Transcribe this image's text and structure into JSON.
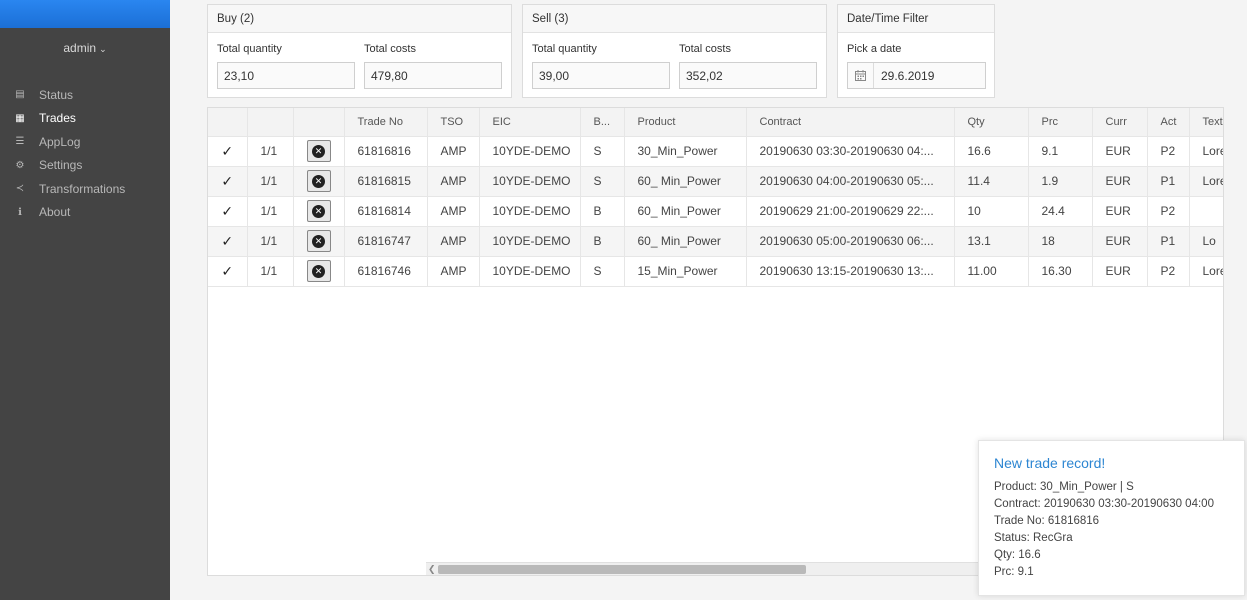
{
  "sidebar": {
    "user": "admin",
    "items": [
      {
        "label": "Status",
        "icon": "status-icon",
        "glyph": "▤",
        "active": false
      },
      {
        "label": "Trades",
        "icon": "document-icon",
        "glyph": "▦",
        "active": true
      },
      {
        "label": "AppLog",
        "icon": "list-icon",
        "glyph": "☰",
        "active": false
      },
      {
        "label": "Settings",
        "icon": "gear-icon",
        "glyph": "⚙",
        "active": false
      },
      {
        "label": "Transformations",
        "icon": "share-icon",
        "glyph": "≺",
        "active": false
      },
      {
        "label": "About",
        "icon": "info-icon",
        "glyph": "ℹ",
        "active": false
      }
    ]
  },
  "buy": {
    "title": "Buy (2)",
    "qty_label": "Total quantity",
    "qty_value": "23,10",
    "cost_label": "Total costs",
    "cost_value": "479,80"
  },
  "sell": {
    "title": "Sell (3)",
    "qty_label": "Total quantity",
    "qty_value": "39,00",
    "cost_label": "Total costs",
    "cost_value": "352,02"
  },
  "filter": {
    "title": "Date/Time Filter",
    "date_label": "Pick a date",
    "date_value": "29.6.2019"
  },
  "table": {
    "columns": [
      "",
      "",
      "",
      "Trade No",
      "TSO",
      "EIC",
      "B...",
      "Product",
      "Contract",
      "Qty",
      "Prc",
      "Curr",
      "Act",
      "Text"
    ],
    "rows": [
      [
        "✓",
        "1/1",
        "",
        "61816816",
        "AMP",
        "10YDE-DEMO",
        "S",
        "30_Min_Power",
        "20190630 03:30-20190630 04:...",
        "16.6",
        "9.1",
        "EUR",
        "P2",
        "Lore"
      ],
      [
        "✓",
        "1/1",
        "",
        "61816815",
        "AMP",
        "10YDE-DEMO",
        "S",
        "60_ Min_Power",
        "20190630 04:00-20190630 05:...",
        "11.4",
        "1.9",
        "EUR",
        "P1",
        "Lore"
      ],
      [
        "✓",
        "1/1",
        "",
        "61816814",
        "AMP",
        "10YDE-DEMO",
        "B",
        "60_ Min_Power",
        "20190629 21:00-20190629 22:...",
        "10",
        "24.4",
        "EUR",
        "P2",
        ""
      ],
      [
        "✓",
        "1/1",
        "",
        "61816747",
        "AMP",
        "10YDE-DEMO",
        "B",
        "60_ Min_Power",
        "20190630 05:00-20190630 06:...",
        "13.1",
        "18",
        "EUR",
        "P1",
        "Lo"
      ],
      [
        "✓",
        "1/1",
        "",
        "61816746",
        "AMP",
        "10YDE-DEMO",
        "S",
        "15_Min_Power",
        "20190630 13:15-20190630 13:...",
        "11.00",
        "16.30",
        "EUR",
        "P2",
        "Lore"
      ]
    ]
  },
  "toast": {
    "title": "New trade record!",
    "lines": [
      "Product: 30_Min_Power | S",
      "Contract: 20190630 03:30-20190630 04:00",
      "Trade No: 61816816",
      "Status: RecGra",
      "Qty: 16.6",
      "Prc: 9.1"
    ]
  },
  "colors": {
    "sidebar_bg": "#444444",
    "topbar": "#1b6fd6",
    "toast_title": "#2d86d2"
  }
}
